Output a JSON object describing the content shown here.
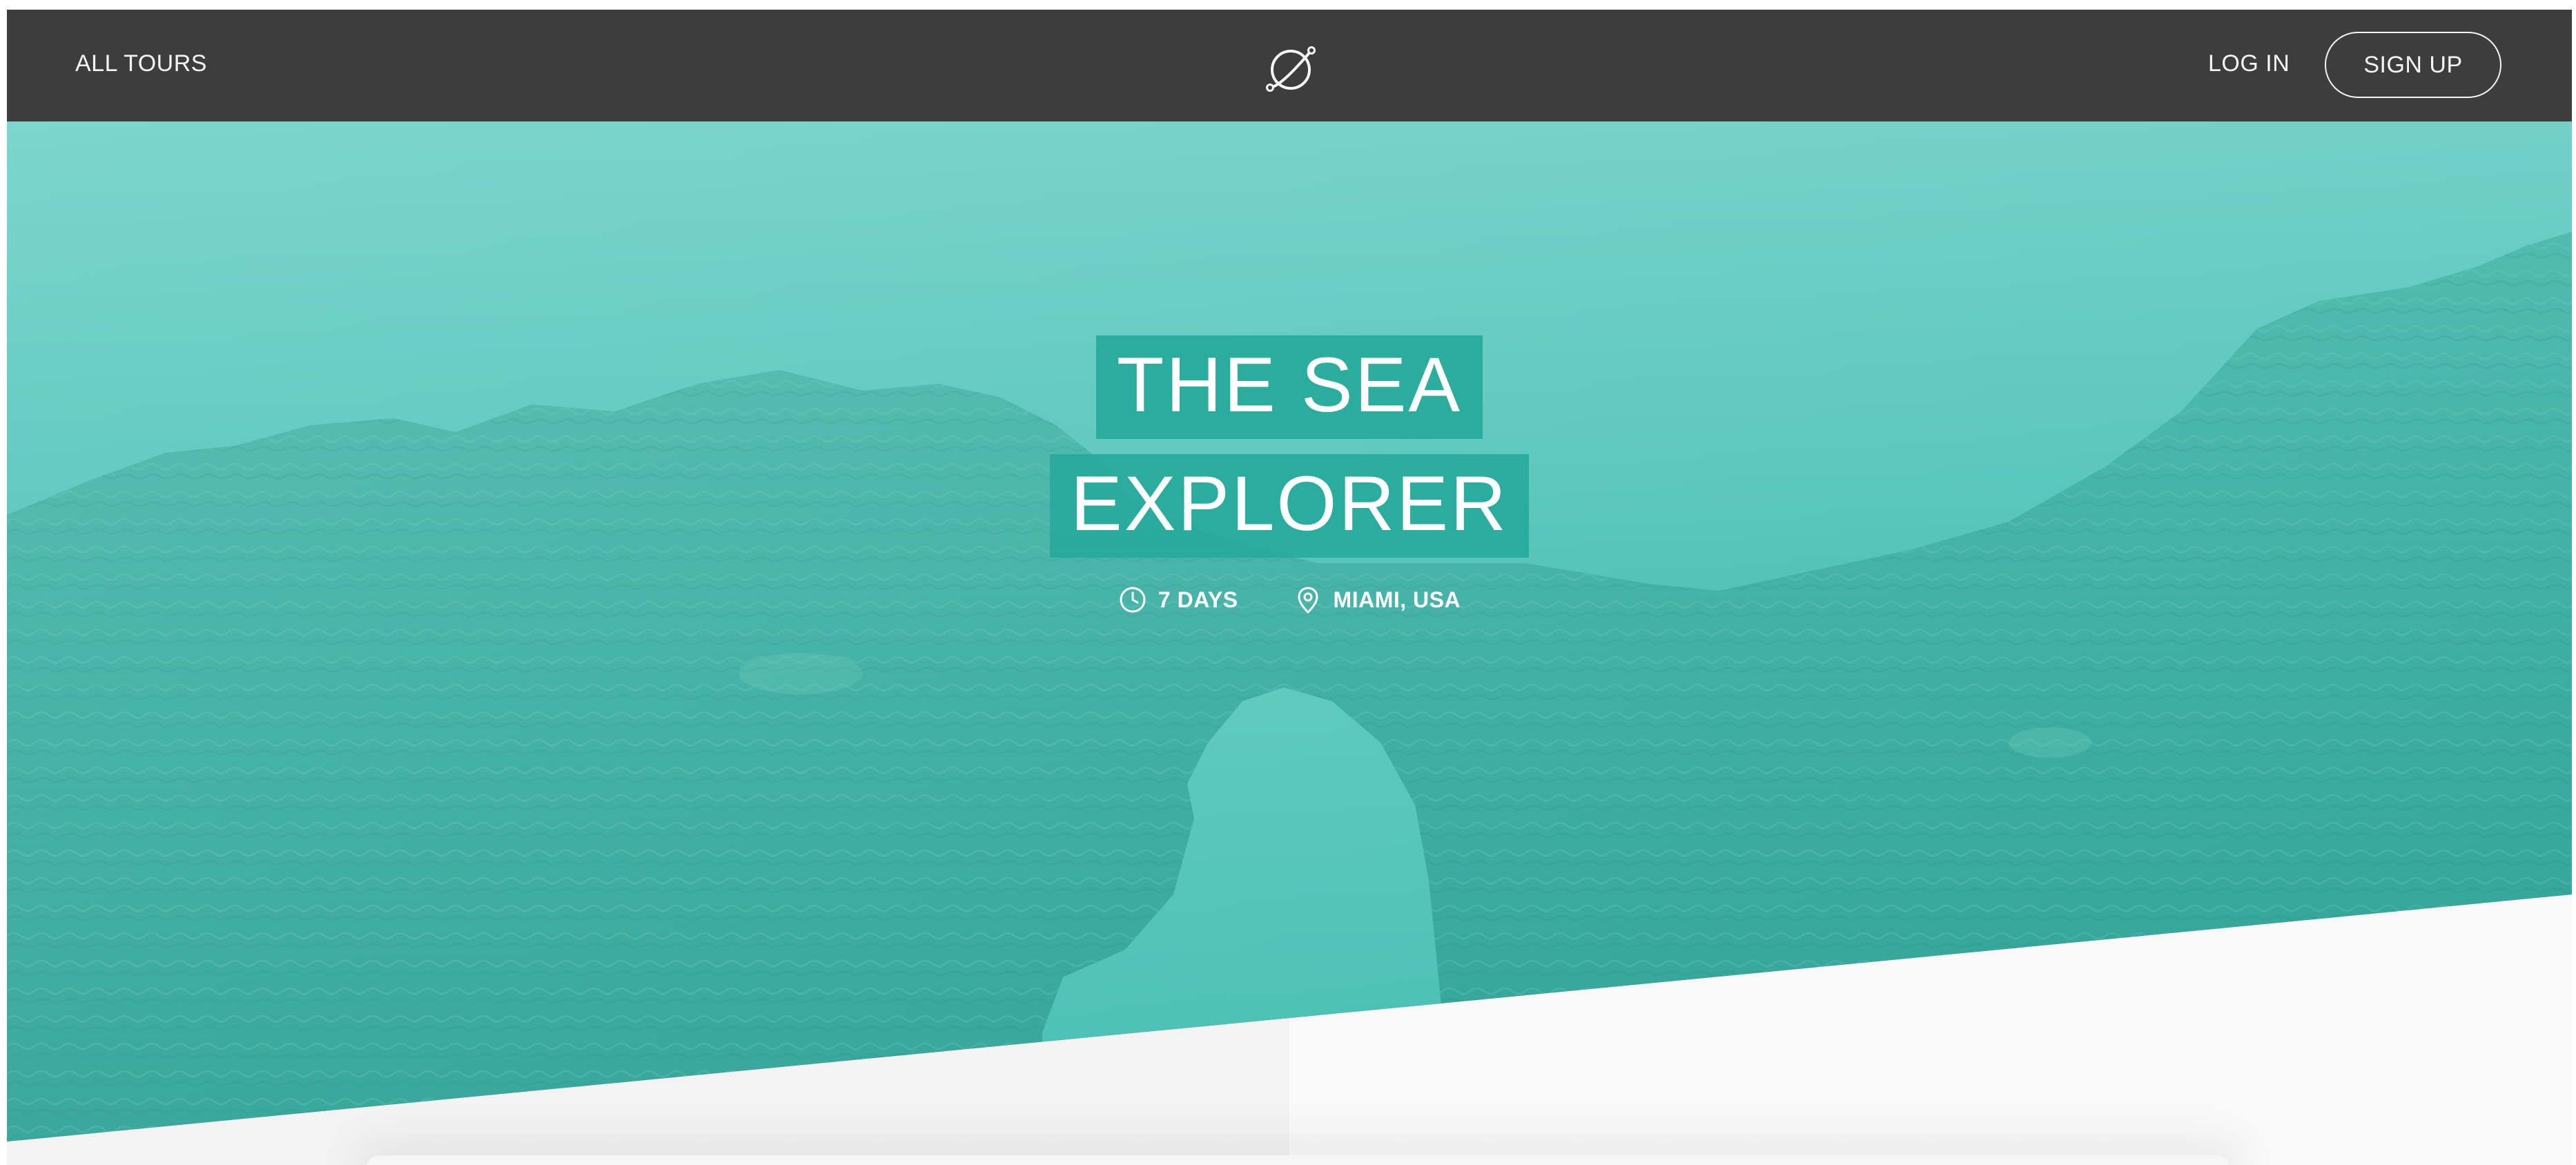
{
  "header": {
    "nav_all_tours": "ALL TOURS",
    "nav_login": "LOG IN",
    "nav_signup": "SIGN UP",
    "logo_icon": "globe-logo-icon"
  },
  "hero": {
    "title_line_1": "THE SEA",
    "title_line_2": "EXPLORER",
    "duration": "7 DAYS",
    "duration_icon": "clock-icon",
    "location": "MIAMI, USA",
    "location_icon": "map-pin-icon"
  },
  "colors": {
    "header_bg": "#3d3d3d",
    "accent_green": "#28b4a0",
    "hero_tint": "#5ec9c0",
    "page_bg": "#f7f7f7"
  }
}
